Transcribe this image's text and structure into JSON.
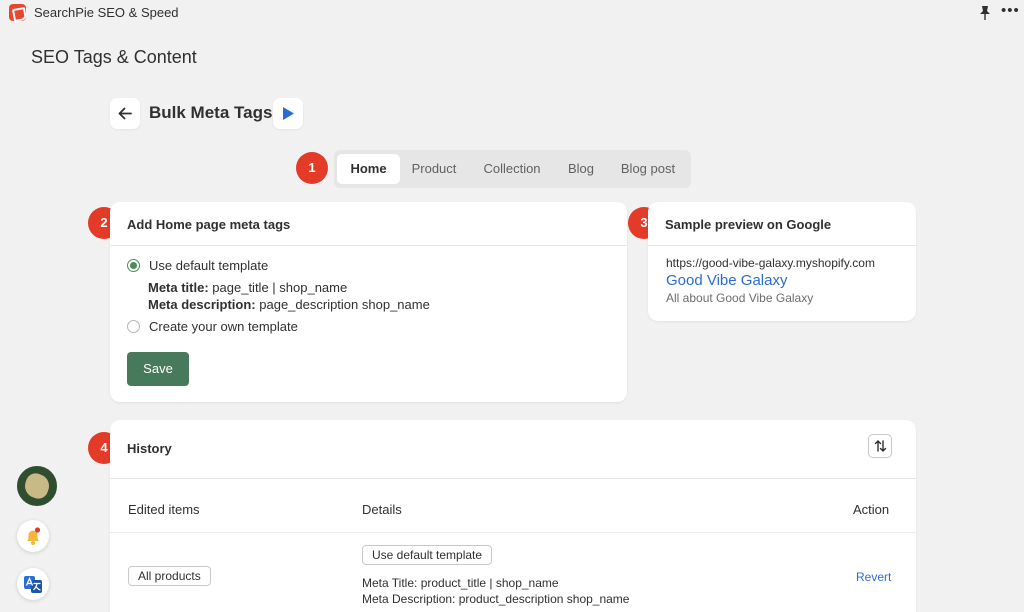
{
  "app": {
    "name": "SearchPie SEO & Speed",
    "more_label": "•••"
  },
  "page": {
    "title": "SEO Tags & Content"
  },
  "subheader": {
    "title": "Bulk Meta Tags"
  },
  "badges": [
    "1",
    "2",
    "3",
    "4"
  ],
  "tabs": [
    {
      "label": "Home",
      "active": true
    },
    {
      "label": "Product",
      "active": false
    },
    {
      "label": "Collection",
      "active": false
    },
    {
      "label": "Blog",
      "active": false
    },
    {
      "label": "Blog post",
      "active": false
    }
  ],
  "meta_card": {
    "title": "Add Home page meta tags",
    "option_default": "Use default template",
    "meta_title_label": "Meta title:",
    "meta_title_value": "page_title | shop_name",
    "meta_desc_label": "Meta description:",
    "meta_desc_value": "page_description shop_name",
    "option_custom": "Create your own template",
    "save_label": "Save",
    "selected_option": "default"
  },
  "preview_card": {
    "title": "Sample preview on Google",
    "url": "https://good-vibe-galaxy.myshopify.com",
    "site_title": "Good Vibe Galaxy",
    "description": "All about Good Vibe Galaxy"
  },
  "history": {
    "title": "History",
    "columns": [
      "Edited items",
      "Details",
      "Action"
    ],
    "rows": [
      {
        "item": "All products",
        "detail_chip": "Use default template",
        "meta_title": "Meta Title: product_title | shop_name",
        "meta_description": "Meta Description: product_description shop_name",
        "action": "Revert"
      }
    ]
  },
  "colors": {
    "accent_red": "#e33b27",
    "save_green": "#477a5a",
    "link_blue": "#2a6cd6",
    "background": "#f1f1f1"
  },
  "icons": [
    "app-logo-icon",
    "pin-icon",
    "back-arrow-icon",
    "play-icon",
    "sort-icon",
    "avatar",
    "bell-icon",
    "translate-icon"
  ]
}
